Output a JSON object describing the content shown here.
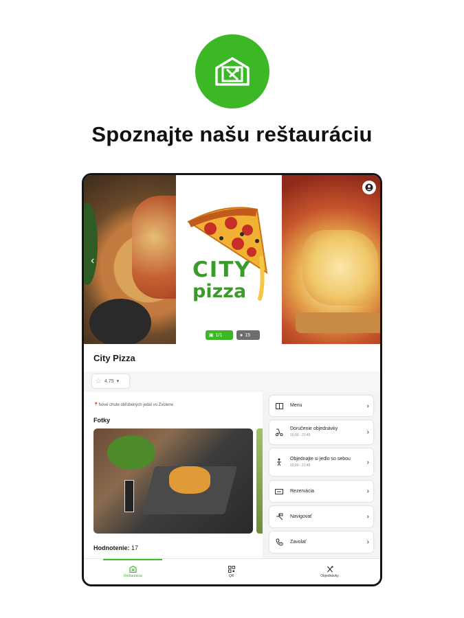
{
  "headline": "Spoznajte našu reštauráciu",
  "accent_color": "#3cb827",
  "logo_icon": "restaurant-home-icon",
  "hero": {
    "brand_line1": "CITY",
    "brand_line2": "pizza",
    "photos_count": "1/1",
    "reviews_count": "15"
  },
  "restaurant": {
    "name": "City Pizza",
    "rating_value": "4.75",
    "tagline": "Nové chute obľúbených jedál vo Zvolene",
    "photos_label": "Fotky",
    "rating_label": "Hodnotenie:",
    "rating_count": "17"
  },
  "actions": [
    {
      "label": "Menu",
      "sub": "",
      "icon": "menu-book-icon"
    },
    {
      "label": "Doručenie objednávky",
      "sub": "10:00 - 21:45",
      "icon": "delivery-icon"
    },
    {
      "label": "Objednajte si jedlo so sebou",
      "sub": "10:00 - 21:45",
      "icon": "takeaway-icon"
    },
    {
      "label": "Rezervácia",
      "sub": "",
      "icon": "reservation-icon"
    },
    {
      "label": "Navigovať",
      "sub": "",
      "icon": "navigation-icon"
    },
    {
      "label": "Zavolať",
      "sub": "",
      "icon": "phone-icon"
    }
  ],
  "bottom_nav": [
    {
      "label": "Reštaurácia",
      "icon": "restaurant-icon"
    },
    {
      "label": "QR",
      "icon": "qr-icon"
    },
    {
      "label": "Objednávky",
      "icon": "cutlery-icon"
    }
  ]
}
